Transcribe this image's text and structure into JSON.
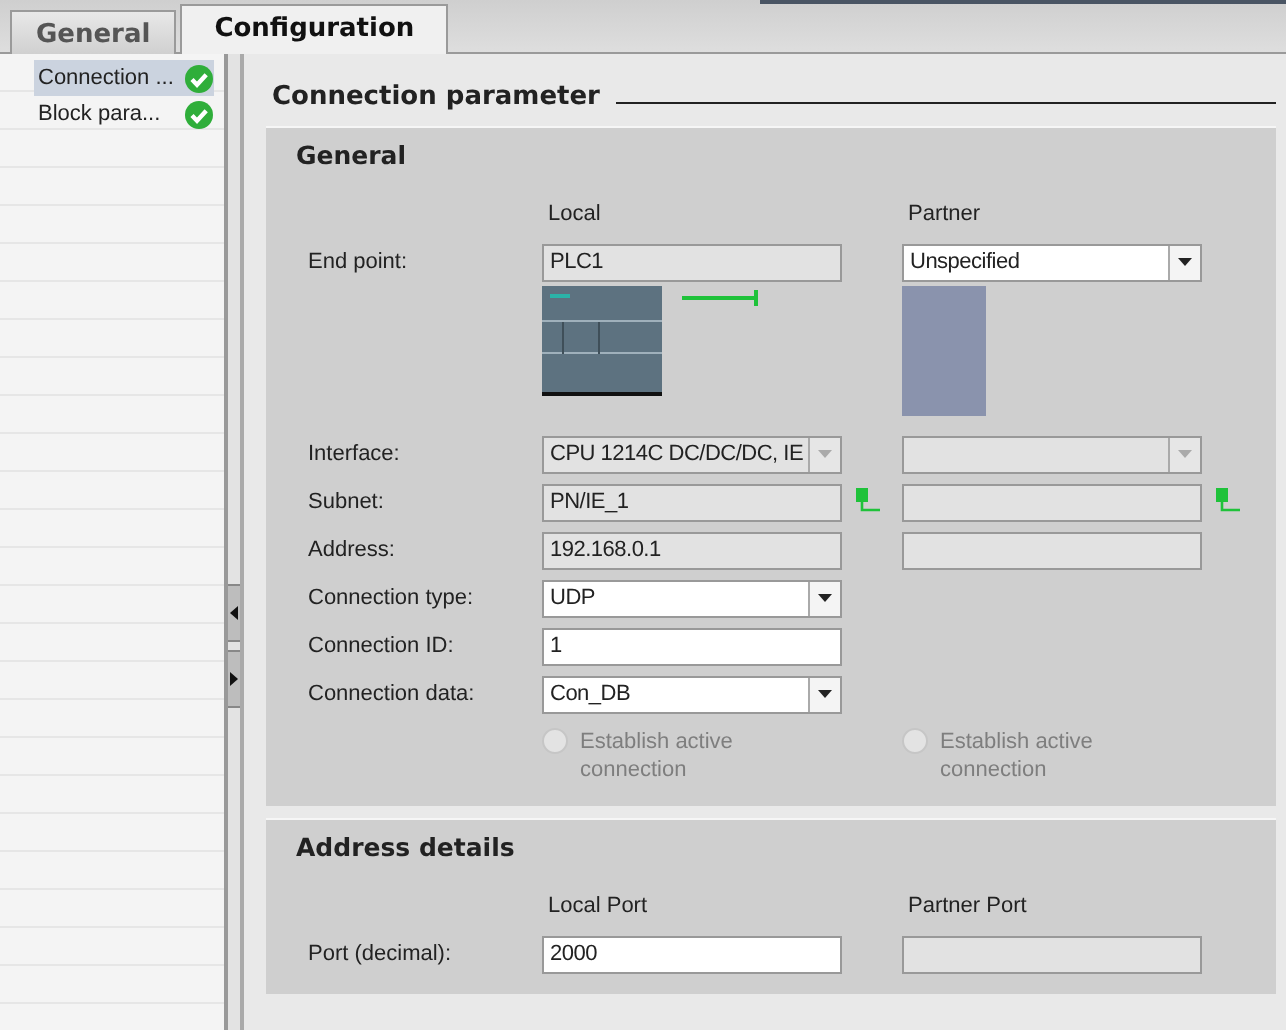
{
  "tabs": [
    {
      "label": "General",
      "selected": false
    },
    {
      "label": "Configuration",
      "selected": true
    }
  ],
  "nav": [
    {
      "label": "Connection ...",
      "selected": true
    },
    {
      "label": "Block para...",
      "selected": false
    }
  ],
  "heading": "Connection parameter",
  "general": {
    "title": "General",
    "columns": [
      "Local",
      "Partner"
    ],
    "rows": [
      {
        "kind": "field",
        "label": "End point:",
        "local": {
          "kind": "text",
          "value": "PLC1",
          "disabled": true
        },
        "partner": {
          "kind": "dropdown",
          "value": "Unspecified",
          "disabled": false
        }
      },
      {
        "kind": "devices"
      },
      {
        "kind": "field",
        "label": "Interface:",
        "local": {
          "kind": "dropdown",
          "value": "CPU 1214C DC/DC/DC, IE",
          "disabled": true
        },
        "partner": {
          "kind": "dropdown",
          "disabled": true
        }
      },
      {
        "kind": "subnet",
        "label": "Subnet:",
        "local": {
          "kind": "text",
          "value": "PN/IE_1",
          "disabled": true
        },
        "partner": {
          "kind": "text",
          "disabled": true
        }
      },
      {
        "kind": "field",
        "label": "Address:",
        "local": {
          "kind": "text",
          "value": "192.168.0.1",
          "disabled": true
        },
        "partner": {
          "kind": "text",
          "disabled": true
        }
      },
      {
        "kind": "field",
        "label": "Connection type:",
        "local": {
          "kind": "dropdown",
          "value": "UDP",
          "disabled": false
        }
      },
      {
        "kind": "field",
        "label": "Connection ID:",
        "local": {
          "kind": "text",
          "value": "1",
          "disabled": false
        }
      },
      {
        "kind": "field",
        "label": "Connection data:",
        "local": {
          "kind": "dropdown",
          "value": "Con_DB",
          "disabled": false
        }
      },
      {
        "kind": "radios",
        "local": {
          "label": "Establish active connection",
          "selected": false,
          "disabled": true
        },
        "partner": {
          "label": "Establish active connection",
          "selected": false,
          "disabled": true
        }
      }
    ]
  },
  "address": {
    "title": "Address details",
    "columns": [
      "Local Port",
      "Partner Port"
    ],
    "rows": [
      {
        "kind": "field",
        "label": "Port (decimal):",
        "local": {
          "kind": "text",
          "value": "2000",
          "disabled": false
        },
        "partner": {
          "kind": "text",
          "disabled": true
        }
      }
    ]
  }
}
